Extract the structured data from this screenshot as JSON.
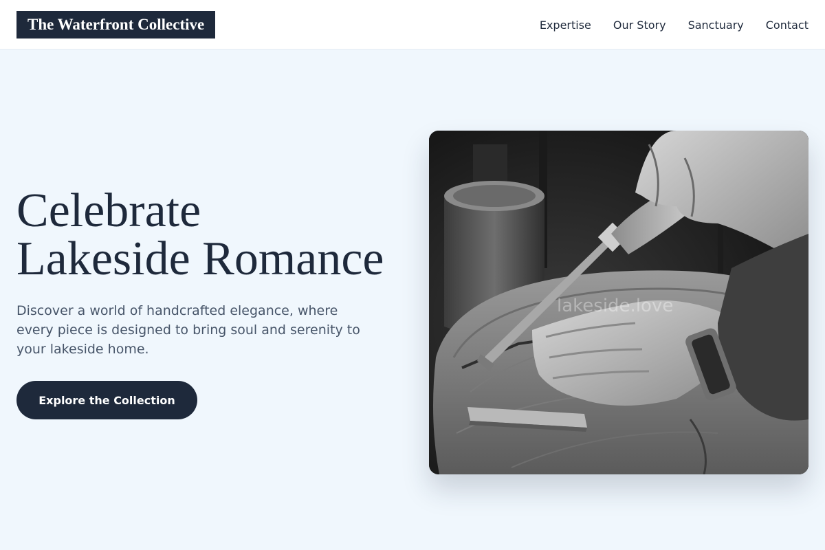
{
  "brand": {
    "name": "The Waterfront Collective"
  },
  "nav": {
    "items": [
      {
        "label": "Expertise"
      },
      {
        "label": "Our Story"
      },
      {
        "label": "Sanctuary"
      },
      {
        "label": "Contact"
      }
    ]
  },
  "hero": {
    "title_line1": "Celebrate",
    "title_line2": "Lakeside Romance",
    "subtitle": "Discover a world of handcrafted elegance, where every piece is designed to bring soul and serenity to your lakeside home.",
    "cta_label": "Explore the Collection",
    "image_watermark": "lakeside.love"
  },
  "colors": {
    "page_background": "#f0f7fd",
    "primary": "#1e293b",
    "text_muted": "#475569"
  },
  "icons": {
    "hero_image": "woodcarving-photo"
  }
}
